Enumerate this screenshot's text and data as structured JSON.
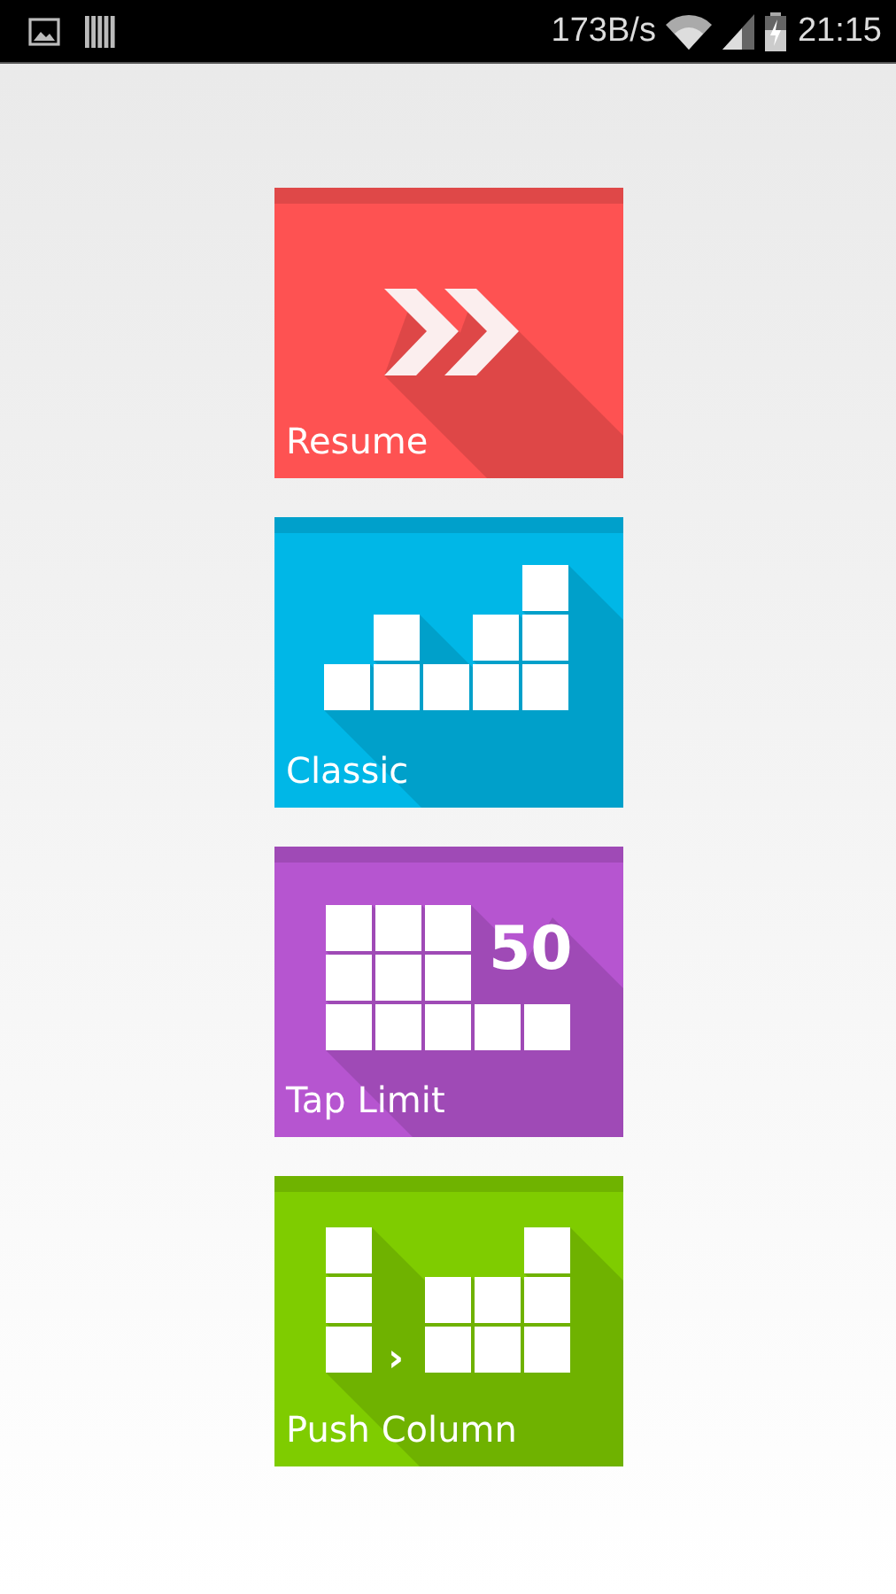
{
  "status_bar": {
    "speed": "173B/s",
    "time": "21:15"
  },
  "tiles": [
    {
      "kind": "resume",
      "label": "Resume",
      "color": "#fe5252"
    },
    {
      "kind": "classic",
      "label": "Classic",
      "color": "#00b7e7"
    },
    {
      "kind": "tap_limit",
      "label": "Tap Limit",
      "color": "#b655d0",
      "count": "50"
    },
    {
      "kind": "push_column",
      "label": "Push Column",
      "color": "#7fcc00",
      "glyph": "›"
    }
  ]
}
